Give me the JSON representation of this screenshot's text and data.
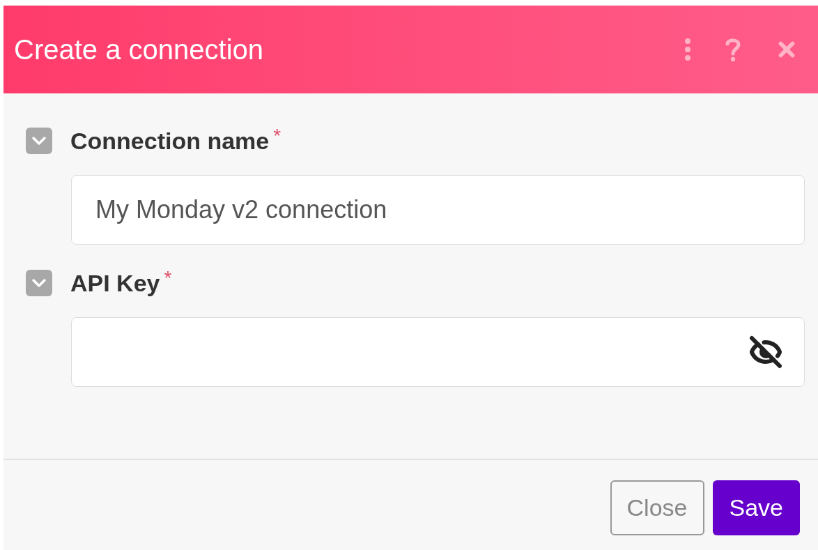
{
  "dialog": {
    "title": "Create a connection"
  },
  "fields": [
    {
      "kind": "text",
      "label": "Connection name",
      "required_mark": "*",
      "value": "My Monday v2 connection"
    },
    {
      "kind": "secret",
      "label": "API Key",
      "required_mark": "*"
    }
  ],
  "buttons": [
    {
      "kind": "secondary",
      "label": "Close"
    },
    {
      "kind": "primary",
      "label": "Save"
    }
  ]
}
